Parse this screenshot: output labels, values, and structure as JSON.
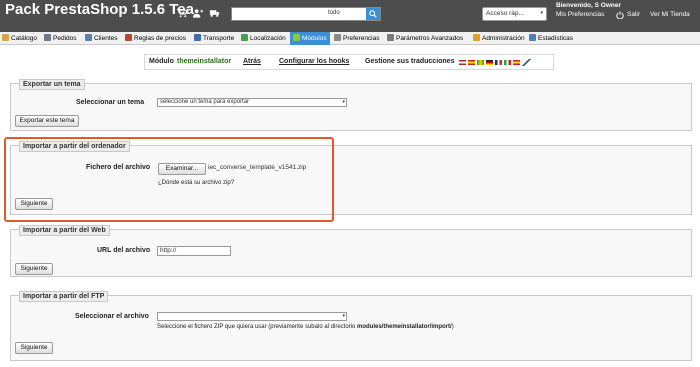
{
  "header": {
    "shop_name": "Pack PrestaShop 1.5.6 Tea",
    "search": {
      "value": "",
      "type": "todo"
    },
    "quick_access": "Acceso ráp...",
    "welcome": "Bienvenido, S Owner",
    "preferences": "Mis Preferencias",
    "logout": "Salir",
    "view_shop": "Ver Mi Tienda",
    "colors": {
      "header_bg": "#4d4d4d",
      "accent": "#3a8fd6"
    }
  },
  "menu": {
    "tabs": [
      {
        "label": "Catálogo",
        "icon": "catalog-icon",
        "color": "#d9a441"
      },
      {
        "label": "Pedidos",
        "icon": "cart-icon",
        "color": "#6d7b8a"
      },
      {
        "label": "Clientes",
        "icon": "customers-icon",
        "color": "#5a7fb0"
      },
      {
        "label": "Reglas de precios",
        "icon": "price-rules-icon",
        "color": "#c0442f"
      },
      {
        "label": "Transporte",
        "icon": "truck-icon",
        "color": "#3f6bb0"
      },
      {
        "label": "Localización",
        "icon": "globe-icon",
        "color": "#46a046"
      },
      {
        "label": "Módulos",
        "icon": "puzzle-icon",
        "color": "#8cc63f"
      },
      {
        "label": "Preferencias",
        "icon": "preferences-icon",
        "color": "#8a8a8a"
      },
      {
        "label": "Parámetros Avanzados",
        "icon": "wrench-icon",
        "color": "#7a7a7a"
      },
      {
        "label": "Administración",
        "icon": "admin-icon",
        "color": "#e0a020"
      },
      {
        "label": "Estadísticas",
        "icon": "stats-icon",
        "color": "#4a7fc0"
      }
    ],
    "active": "Módulos"
  },
  "submenu": {
    "module_label": "Módulo",
    "module_name": "themeinstallator",
    "back": "Atrás",
    "configure_hooks": "Configurar los hooks",
    "translations": "Gestione sus traducciones"
  },
  "export_theme": {
    "legend": "Exportar un tema",
    "select_label": "Seleccionar un tema",
    "select_value": "seleccione un tema para exportar",
    "button": "Exportar este tema"
  },
  "import_computer": {
    "legend": "Importar a partir del ordenador",
    "file_label": "Fichero del archivo",
    "browse_button": "Examinar...",
    "file_name": "iec_converse_template_v1541.zip",
    "help_link": "¿Dónde está su archivo zip?",
    "next_button": "Siguiente"
  },
  "import_web": {
    "legend": "Importar a partir del Web",
    "url_label": "URL del archivo",
    "url_value": "http://",
    "next_button": "Siguiente"
  },
  "import_ftp": {
    "legend": "Importar a partir del FTP",
    "select_label": "Seleccionar el archivo",
    "select_value": "",
    "hint_prefix": "Seleccione el fichero ZIP que quiera usar (previamente subalo al directorio ",
    "hint_path": "modules/themeinstallator/import/",
    "hint_suffix": ")",
    "next_button": "Siguiente"
  }
}
